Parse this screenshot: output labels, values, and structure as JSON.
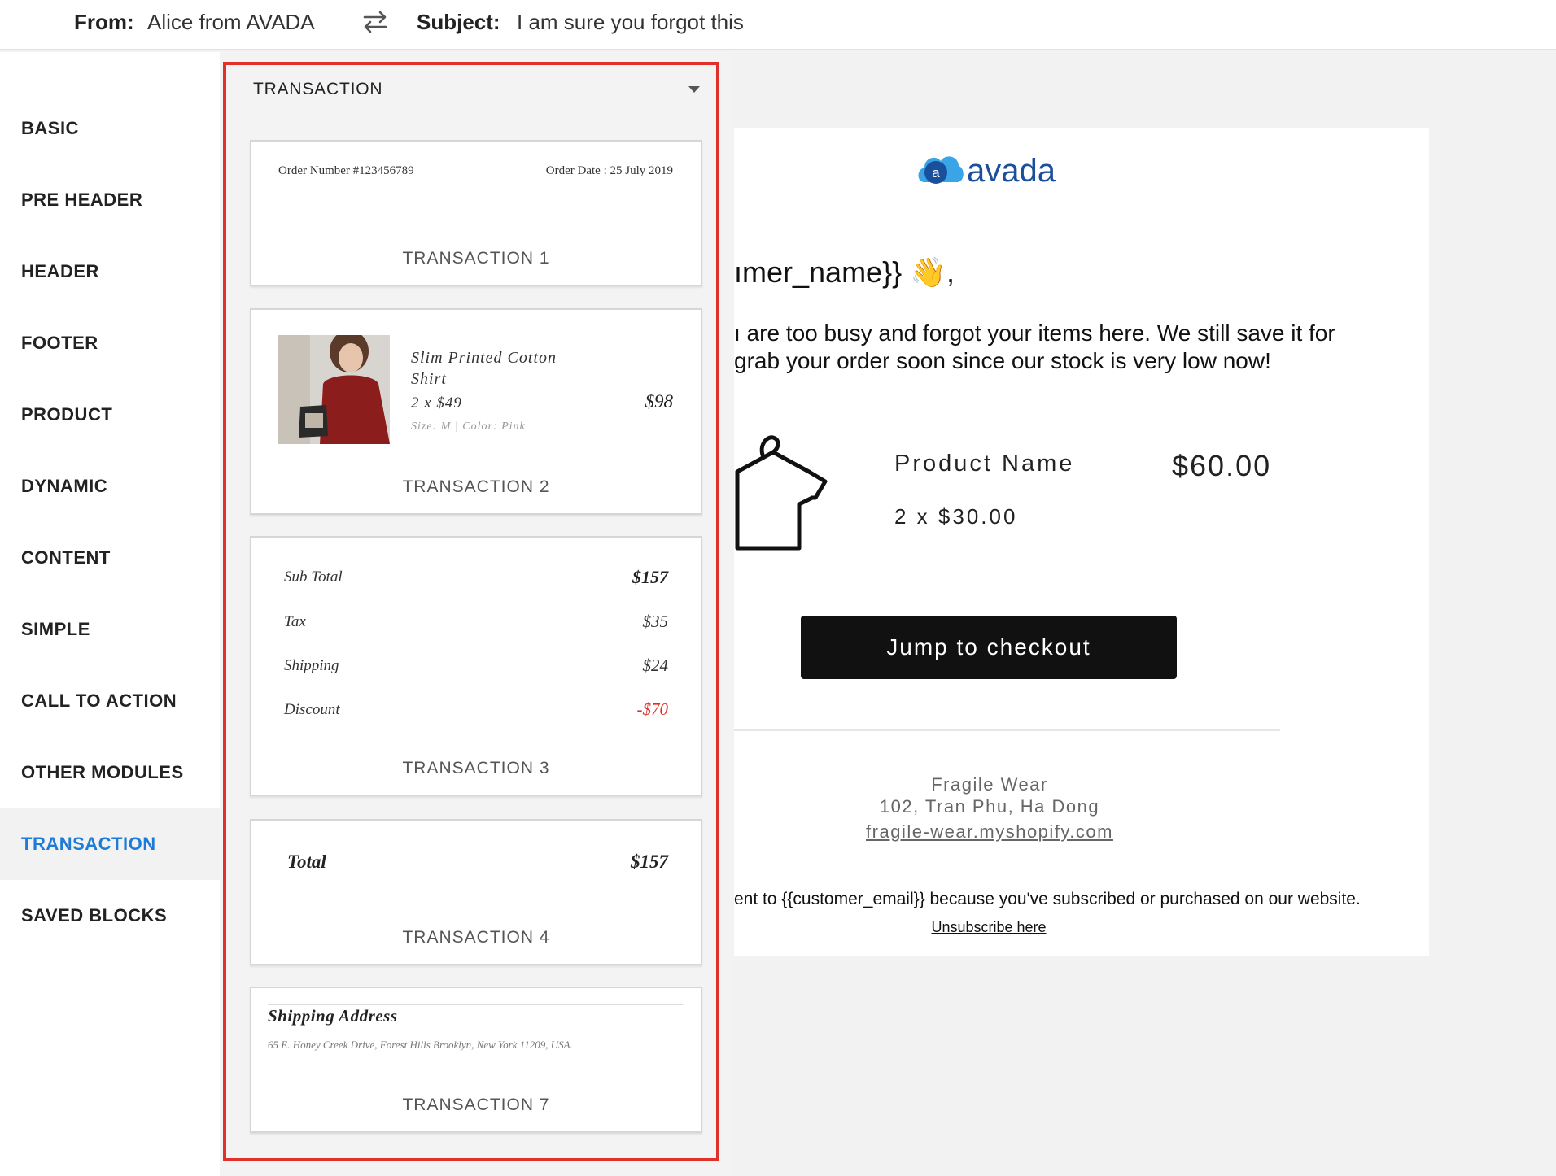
{
  "topbar": {
    "from_label": "From:",
    "from_value": "Alice from AVADA",
    "subject_label": "Subject:",
    "subject_value": "I am sure you forgot this"
  },
  "nav": {
    "items": [
      "BASIC",
      "PRE HEADER",
      "HEADER",
      "FOOTER",
      "PRODUCT",
      "DYNAMIC",
      "CONTENT",
      "SIMPLE",
      "CALL TO ACTION",
      "OTHER MODULES",
      "TRANSACTION",
      "SAVED BLOCKS"
    ],
    "active": "TRANSACTION",
    "active_color": "#1e7cd8"
  },
  "panel": {
    "title": "TRANSACTION",
    "highlight_color": "#e0302a",
    "cards": {
      "t1": {
        "order_number": "Order Number #123456789",
        "order_date": "Order Date : 25 July 2019",
        "label": "TRANSACTION 1"
      },
      "t2": {
        "product_name_line1": "Slim Printed Cotton",
        "product_name_line2": "Shirt",
        "qty_price": "2 x $49",
        "variant": "Size: M | Color: Pink",
        "total": "$98",
        "label": "TRANSACTION 2"
      },
      "t3": {
        "rows": [
          {
            "name": "Sub Total",
            "value": "$157"
          },
          {
            "name": "Tax",
            "value": "$35"
          },
          {
            "name": "Shipping",
            "value": "$24"
          },
          {
            "name": "Discount",
            "value": "-$70"
          }
        ],
        "discount_color": "#e0302a",
        "label": "TRANSACTION 3"
      },
      "t4": {
        "name": "Total",
        "value": "$157",
        "label": "TRANSACTION 4"
      },
      "t7": {
        "title": "Shipping Address",
        "address": "65 E. Honey Creek Drive, Forest Hills Brooklyn, New York 11209, USA.",
        "label": "TRANSACTION 7"
      }
    }
  },
  "email": {
    "logo_text": "avada",
    "logo_letter": "a",
    "greeting": "ımer_name}} 👋,",
    "body_line1": "ı are too busy and forgot your items here. We still save it for",
    "body_line2": " grab your order soon since our stock is very low now!",
    "product_name": "Product Name",
    "product_qty": "2 x $30.00",
    "product_price": "$60.00",
    "cta": "Jump to checkout",
    "shop_name": "Fragile Wear",
    "shop_address": "102, Tran Phu, Ha Dong",
    "shop_url": "fragile-wear.myshopify.com",
    "sent_text": "ent to {{customer_email}} because you've subscribed or purchased on our website.",
    "unsubscribe": "Unsubscribe here"
  }
}
